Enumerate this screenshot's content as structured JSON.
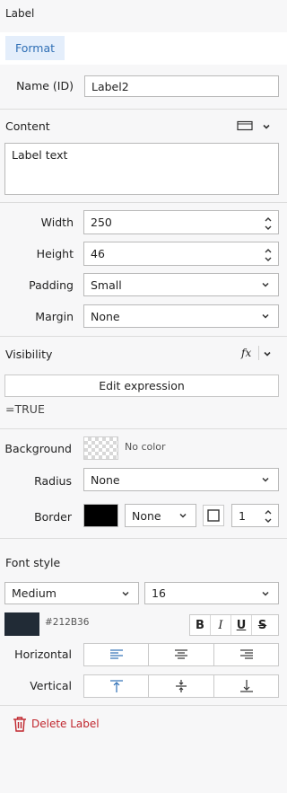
{
  "panel": {
    "title": "Label"
  },
  "tabs": {
    "format_label": "Format"
  },
  "name_id": {
    "label": "Name (ID)",
    "value": "Label2"
  },
  "content": {
    "title": "Content",
    "text": "Label text"
  },
  "size": {
    "width_label": "Width",
    "width_value": "250",
    "height_label": "Height",
    "height_value": "46",
    "padding_label": "Padding",
    "padding_value": "Small",
    "margin_label": "Margin",
    "margin_value": "None"
  },
  "visibility": {
    "title": "Visibility",
    "fx_label": "fx",
    "edit_button": "Edit expression",
    "expression": "=TRUE"
  },
  "appearance": {
    "background_label": "Background",
    "background_value": "No color",
    "radius_label": "Radius",
    "radius_value": "None",
    "border_label": "Border",
    "border_style": "None",
    "border_width": "1",
    "border_color": "#000000"
  },
  "font": {
    "title": "Font style",
    "weight": "Medium",
    "size": "16",
    "color_hex": "#212B36",
    "bold": "B",
    "italic": "I",
    "underline": "U",
    "strike": "S",
    "horizontal_label": "Horizontal",
    "vertical_label": "Vertical"
  },
  "actions": {
    "delete_label": "Delete Label"
  },
  "colors": {
    "accent": "#2f6fb5",
    "danger": "#c0262d",
    "text_color_swatch": "#212b36"
  }
}
